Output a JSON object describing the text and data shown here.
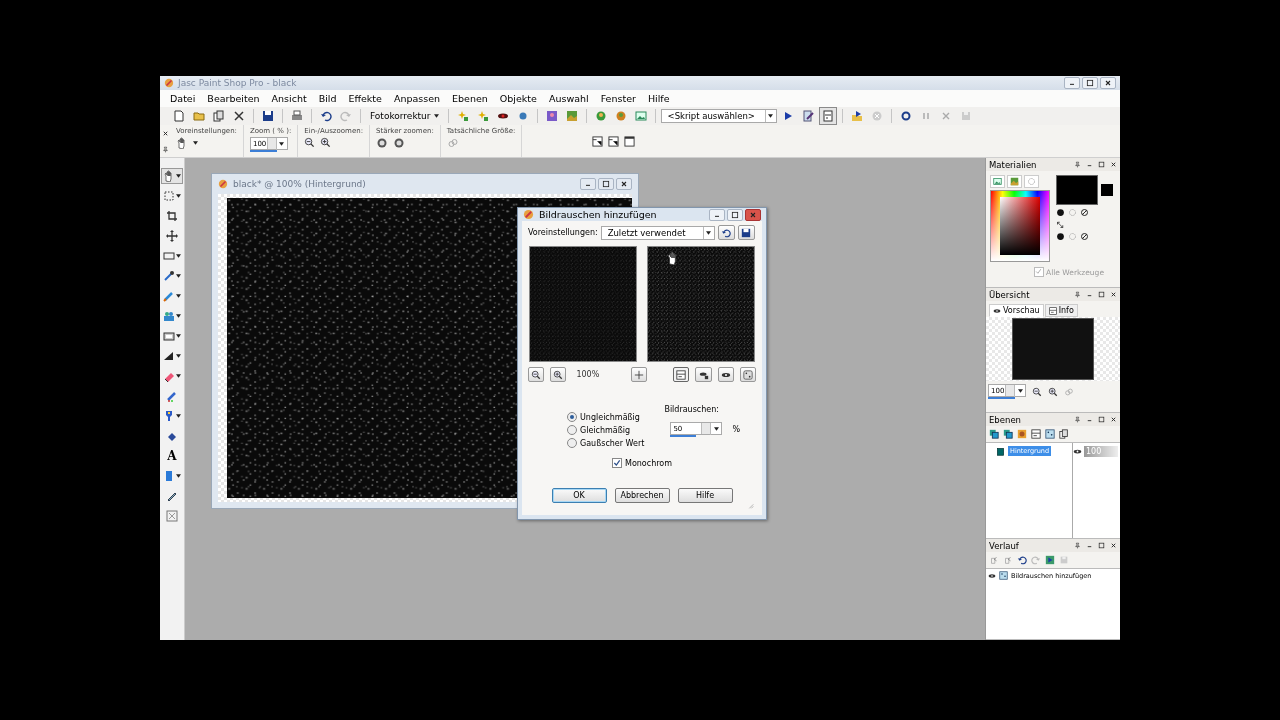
{
  "window": {
    "title": "Jasc Paint Shop Pro - black"
  },
  "menu": [
    "Datei",
    "Bearbeiten",
    "Ansicht",
    "Bild",
    "Effekte",
    "Anpassen",
    "Ebenen",
    "Objekte",
    "Auswahl",
    "Fenster",
    "Hilfe"
  ],
  "toolbar": {
    "photo_fix_dropdown": "Fotokorrektur",
    "script_select": "<Skript auswählen>"
  },
  "tool_options": {
    "groups": [
      {
        "label": "Voreinstellungen:",
        "kind": "preset"
      },
      {
        "label": "Zoom ( % ):",
        "kind": "zoom",
        "value": "100",
        "level": 0.7
      },
      {
        "label": "Ein-/Auszoomen:",
        "kind": "inout"
      },
      {
        "label": "Stärker zoomen:",
        "kind": "more"
      },
      {
        "label": "Tatsächliche Größe:",
        "kind": "actual"
      }
    ]
  },
  "tools": {
    "text_tool_glyph": "A"
  },
  "image_window": {
    "title": "black* @ 100% (Hintergrund)"
  },
  "dialog": {
    "title": "Bildrauschen hinzufügen",
    "presets_label": "Voreinstellungen:",
    "presets_value": "Zuletzt verwendet",
    "preview_zoom": "100%",
    "noise_types": [
      {
        "label": "Ungleichmäßig",
        "selected": true
      },
      {
        "label": "Gleichmäßig",
        "selected": false
      },
      {
        "label": "Gaußscher Wert",
        "selected": false
      }
    ],
    "noise": {
      "label": "Bildrauschen:",
      "value": "50",
      "level": 0.5,
      "unit": "%"
    },
    "monochrome": {
      "label": "Monochrom",
      "checked": true
    },
    "buttons": [
      {
        "label": "OK",
        "default": true
      },
      {
        "label": "Abbrechen",
        "default": false
      },
      {
        "label": "Hilfe",
        "default": false
      }
    ]
  },
  "panels": {
    "materials": {
      "title": "Materialien",
      "all_tools": {
        "label": "Alle Werkzeuge",
        "checked": true,
        "disabled": true
      }
    },
    "overview": {
      "title": "Übersicht",
      "tabs": [
        {
          "label": "Vorschau",
          "selected": true
        },
        {
          "label": "Info",
          "selected": false
        }
      ],
      "zoom": "100",
      "level": 0.7
    },
    "layers": {
      "title": "Ebenen",
      "layers": [
        {
          "name": "Hintergrund",
          "selected": true,
          "opacity": "100"
        }
      ]
    },
    "history": {
      "title": "Verlauf",
      "items": [
        "Bildrauschen hinzufügen"
      ]
    }
  }
}
